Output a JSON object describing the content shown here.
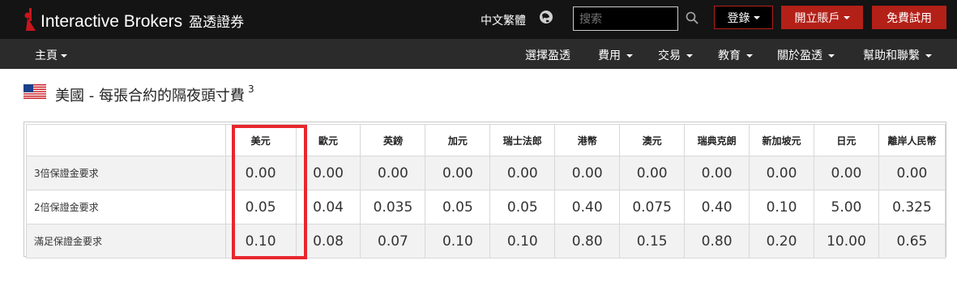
{
  "header": {
    "brand": "Interactive Brokers",
    "brand_cn": "盈透證券",
    "language": "中文繁體",
    "search_placeholder": "搜索",
    "login_label": "登錄",
    "open_account_label": "開立賬戶",
    "free_trial_label": "免費試用",
    "accent_color": "#b32018"
  },
  "nav": {
    "home": "主頁",
    "items": [
      "選擇盈透",
      "費用",
      "交易",
      "教育",
      "關於盈透",
      "幫助和聯繫"
    ]
  },
  "section": {
    "title": "美國 - 每張合約的隔夜頭寸費",
    "footnote": "3"
  },
  "table": {
    "columns": [
      "美元",
      "歐元",
      "英鎊",
      "加元",
      "瑞士法郎",
      "港幣",
      "澳元",
      "瑞典克朗",
      "新加坡元",
      "日元",
      "離岸人民幣"
    ],
    "rows": [
      {
        "label": "3倍保證金要求",
        "values": [
          "0.00",
          "0.00",
          "0.00",
          "0.00",
          "0.00",
          "0.00",
          "0.00",
          "0.00",
          "0.00",
          "0.00",
          "0.00"
        ]
      },
      {
        "label": "2倍保證金要求",
        "values": [
          "0.05",
          "0.04",
          "0.035",
          "0.05",
          "0.05",
          "0.40",
          "0.075",
          "0.40",
          "0.10",
          "5.00",
          "0.325"
        ]
      },
      {
        "label": "滿足保證金要求",
        "values": [
          "0.10",
          "0.08",
          "0.07",
          "0.10",
          "0.10",
          "0.80",
          "0.15",
          "0.80",
          "0.20",
          "10.00",
          "0.65"
        ]
      }
    ],
    "highlight_color": "#e8262d"
  }
}
